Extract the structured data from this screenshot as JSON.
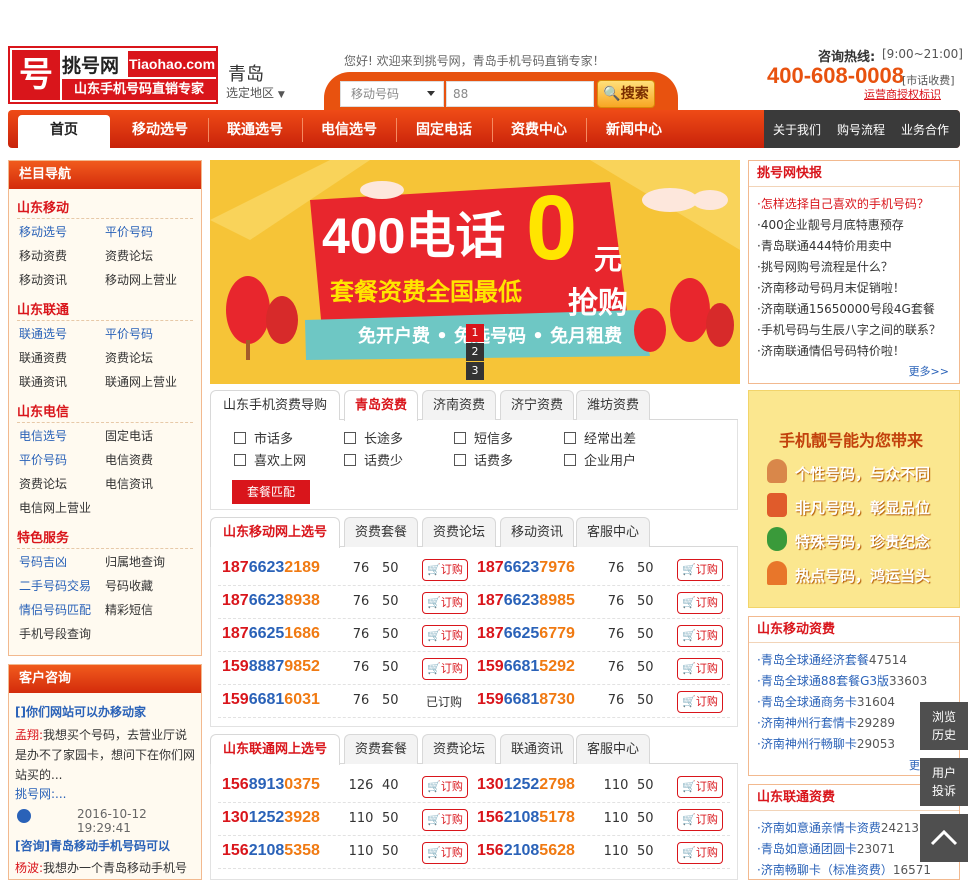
{
  "header": {
    "logo_mark": "号",
    "logo_cn": "挑号网",
    "logo_en": "Tiaohao.com",
    "logo_sub": "山东手机号码直销专家",
    "city": "青岛",
    "city_select": "选定地区",
    "welcome": "您好! 欢迎来到挑号网，青岛手机号码直销专家！",
    "search_select": "移动号码",
    "search_input": "88",
    "search_button": "搜索",
    "hotline_label": "咨询热线:",
    "hotline_hours": "[9:00~21:00]",
    "hotline_number": "400-608-0008",
    "hotline_note": "[市话收费]",
    "trademark": "运营商授权标识"
  },
  "nav": {
    "items": [
      "首页",
      "移动选号",
      "联通选号",
      "电信选号",
      "固定电话",
      "资费中心",
      "新闻中心"
    ],
    "right_items": [
      "关于我们",
      "购号流程",
      "业务合作"
    ]
  },
  "sidebar": {
    "title": "栏目导航",
    "sections": [
      {
        "title": "山东移动",
        "links": [
          [
            "移动选号",
            "平价号码"
          ],
          [
            "移动资费",
            "资费论坛"
          ],
          [
            "移动资讯",
            "移动网上营业"
          ]
        ]
      },
      {
        "title": "山东联通",
        "links": [
          [
            "联通选号",
            "平价号码"
          ],
          [
            "联通资费",
            "资费论坛"
          ],
          [
            "联通资讯",
            "联通网上营业"
          ]
        ]
      },
      {
        "title": "山东电信",
        "links": [
          [
            "电信选号",
            "固定电话"
          ],
          [
            "平价号码",
            "电信资费"
          ],
          [
            "资费论坛",
            "电信资讯"
          ],
          [
            "电信网上营业",
            ""
          ]
        ]
      },
      {
        "title": "特色服务",
        "links": [
          [
            "号码吉凶",
            "归属地查询"
          ],
          [
            "二手号码交易",
            "号码收藏"
          ],
          [
            "情侣号码匹配",
            "精彩短信"
          ],
          [
            "手机号段查询",
            ""
          ]
        ]
      }
    ],
    "consult": {
      "title": "客户咨询",
      "q1": "[]你们网站可以办移动家",
      "q1_user": "孟翔:",
      "q1_text": "我想买个号码，去营业厅说是办不了家园卡，想问下在你们网站买的...",
      "a1_user": "挑号网:...",
      "a1_time": "2016-10-12 19:29:41",
      "q2": "[咨询]青岛移动手机号码可以",
      "q2_user": "杨波:",
      "q2_text": "我想办一个青岛移动手机号"
    }
  },
  "banner": {
    "big": "400电话",
    "zero": "0",
    "yuan": "元",
    "grab": "抢购",
    "sub": "套餐资费全国最低",
    "ribbon": "免开户费 • 免选号码 • 免月租费",
    "pages": [
      "1",
      "2",
      "3"
    ]
  },
  "tariff": {
    "tabs": [
      "山东手机资费导购",
      "青岛资费",
      "济南资费",
      "济宁资费",
      "潍坊资费"
    ],
    "options": [
      [
        "市话多",
        "长途多",
        "短信多",
        "经常出差"
      ],
      [
        "喜欢上网",
        "话费少",
        "话费多",
        "企业用户"
      ]
    ],
    "button": "套餐匹配"
  },
  "mobile": {
    "tabs": [
      "山东移动网上选号",
      "资费套餐",
      "资费论坛",
      "移动资讯",
      "客服中心"
    ],
    "rows": [
      [
        [
          "187",
          "6623",
          "2189",
          "76",
          "50",
          "订购"
        ],
        [
          "187",
          "6623",
          "7976",
          "76",
          "50",
          "订购"
        ]
      ],
      [
        [
          "187",
          "6623",
          "8938",
          "76",
          "50",
          "订购"
        ],
        [
          "187",
          "6623",
          "8985",
          "76",
          "50",
          "订购"
        ]
      ],
      [
        [
          "187",
          "6625",
          "1686",
          "76",
          "50",
          "订购"
        ],
        [
          "187",
          "6625",
          "6779",
          "76",
          "50",
          "订购"
        ]
      ],
      [
        [
          "159",
          "8887",
          "9852",
          "76",
          "50",
          "订购"
        ],
        [
          "159",
          "6681",
          "5292",
          "76",
          "50",
          "订购"
        ]
      ],
      [
        [
          "159",
          "6681",
          "6031",
          "76",
          "50",
          "已订购"
        ],
        [
          "159",
          "6681",
          "8730",
          "76",
          "50",
          "订购"
        ]
      ]
    ]
  },
  "unicom": {
    "tabs": [
      "山东联通网上选号",
      "资费套餐",
      "资费论坛",
      "联通资讯",
      "客服中心"
    ],
    "rows": [
      [
        [
          "156",
          "8913",
          "0375",
          "126",
          "40",
          "订购"
        ],
        [
          "130",
          "1252",
          "2798",
          "110",
          "50",
          "订购"
        ]
      ],
      [
        [
          "130",
          "1252",
          "3928",
          "110",
          "50",
          "订购"
        ],
        [
          "156",
          "2108",
          "5178",
          "110",
          "50",
          "订购"
        ]
      ],
      [
        [
          "156",
          "2108",
          "5358",
          "110",
          "50",
          "订购"
        ],
        [
          "156",
          "2108",
          "5628",
          "110",
          "50",
          "订购"
        ]
      ]
    ]
  },
  "news": {
    "title": "挑号网快报",
    "items": [
      "·怎样选择自己喜欢的手机号码？",
      "·400企业靓号月底特惠预存",
      "·青岛联通444特价用卖中",
      "·挑号网购号流程是什么？",
      "·济南移动号码月末促销啦！",
      "·济南联通15650000号段4G套餐",
      "·手机号码与生辰八字之间的联系？",
      "·济南联通情侣号码特价啦！"
    ],
    "more": "更多>>"
  },
  "promo": {
    "title": "手机靓号能为您带来",
    "items": [
      "个性号码，与众不同",
      "非凡号码，彰显品位",
      "特殊号码，珍贵纪念",
      "热点号码，鸿运当头"
    ]
  },
  "mobile_fee": {
    "title": "山东移动资费",
    "items": [
      [
        "·青岛全球通经济套餐",
        "47514"
      ],
      [
        "·青岛全球通88套餐G3版",
        "33603"
      ],
      [
        "·青岛全球通商务卡",
        "31604"
      ],
      [
        "·济南神州行套情卡",
        "29289"
      ],
      [
        "·济南神州行畅聊卡",
        "29053"
      ]
    ],
    "more": "更多"
  },
  "unicom_fee": {
    "title": "山东联通资费",
    "items": [
      [
        "·济南如意通亲情卡资费",
        "24213"
      ],
      [
        "·青岛如意通团圆卡",
        "23071"
      ],
      [
        "·济南畅聊卡（标准资费）",
        "16571"
      ]
    ]
  },
  "float": {
    "history": "浏览历史",
    "complaint": "用户投诉"
  }
}
